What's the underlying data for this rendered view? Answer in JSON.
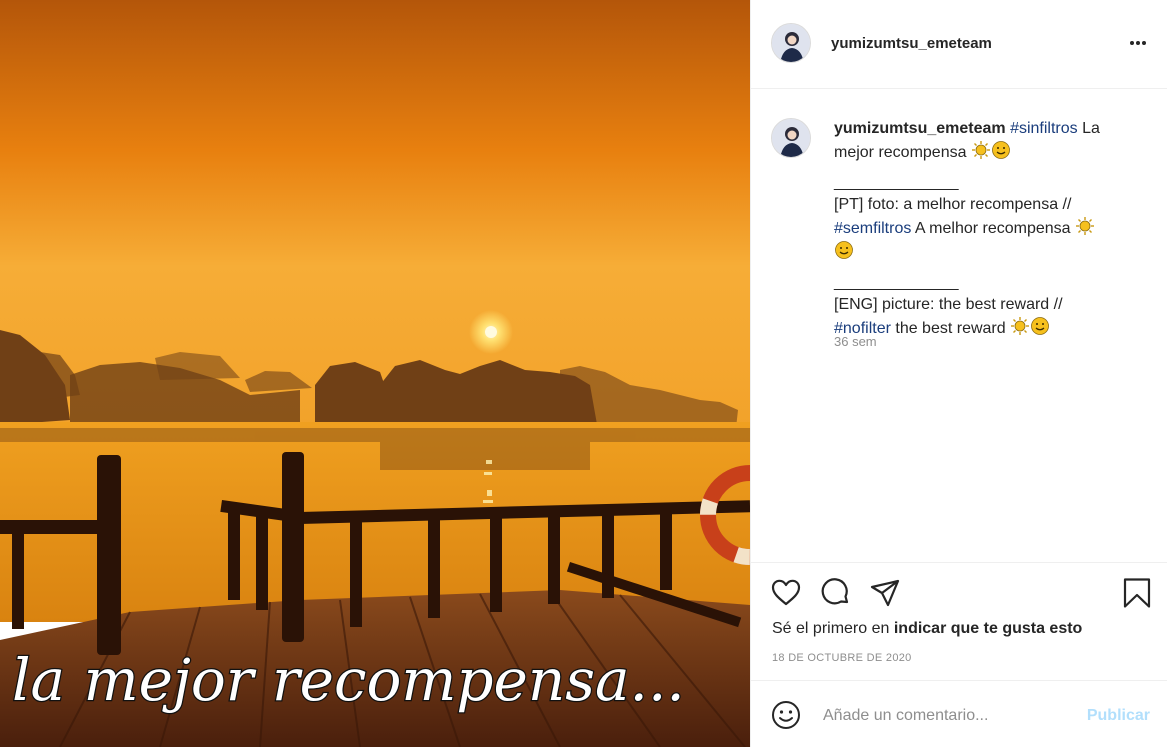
{
  "post": {
    "image_overlay_text": "la mejor recompensa...",
    "colors": {
      "sky_top": "#c2600a",
      "sky_mid": "#f08a14",
      "sky_horizon": "#f7b23a",
      "water": "#e39317",
      "deck": "#6a2f14",
      "hashtag": "#1a3d7c",
      "publish_disabled": "#b2dffc"
    }
  },
  "header": {
    "username": "yumizumtsu_emeteam",
    "avatar_icon": "user-avatar",
    "more_icon": "more-options-icon"
  },
  "caption": {
    "username": "yumizumtsu_emeteam",
    "tag1": "#sinfiltros",
    "line1": " La mejor recompensa ",
    "sep1": "______________",
    "pt_text": "[PT] foto: a melhor recompensa //",
    "tag2": "#semfiltros",
    "pt_text2": " A melhor recompensa ",
    "sep2": "______________",
    "eng_text": "[ENG] picture: the best reward //",
    "tag3": "#nofilter",
    "eng_text2": " the best reward ",
    "age": "36 sem"
  },
  "actions": {
    "icons": [
      "heart-icon",
      "comment-icon",
      "share-icon",
      "bookmark-icon"
    ],
    "likes_prefix": "Sé el primero en ",
    "likes_bold": "indicar que te gusta esto",
    "date": "18 DE OCTUBRE DE 2020"
  },
  "comment": {
    "emoji_icon": "emoji-icon",
    "placeholder": "Añade un comentario...",
    "publish_label": "Publicar"
  }
}
